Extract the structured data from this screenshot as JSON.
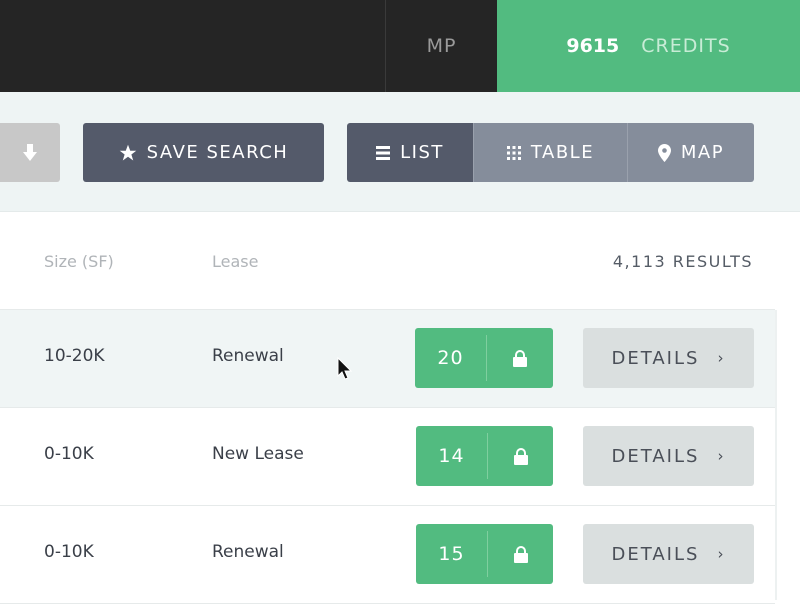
{
  "topbar": {
    "user_initials": "MP",
    "credits_count": "9615",
    "credits_label": "CREDITS"
  },
  "toolbar": {
    "save_search_label": "SAVE SEARCH",
    "view_list_label": "LIST",
    "view_table_label": "TABLE",
    "view_map_label": "MAP",
    "active_view": "LIST"
  },
  "table": {
    "columns": [
      "Size (SF)",
      "Lease"
    ],
    "results_label": "4,113 RESULTS",
    "details_label": "DETAILS",
    "rows": [
      {
        "size": "10-20K",
        "lease": "Renewal",
        "credits": "20"
      },
      {
        "size": "0-10K",
        "lease": "New Lease",
        "credits": "14"
      },
      {
        "size": "0-10K",
        "lease": "Renewal",
        "credits": "15"
      }
    ]
  },
  "colors": {
    "topbar": "#252525",
    "accent_green": "#52bb80",
    "dark_button": "#545a6a",
    "inactive_button": "#858d9b",
    "toolbar_bg": "#eef4f4"
  }
}
